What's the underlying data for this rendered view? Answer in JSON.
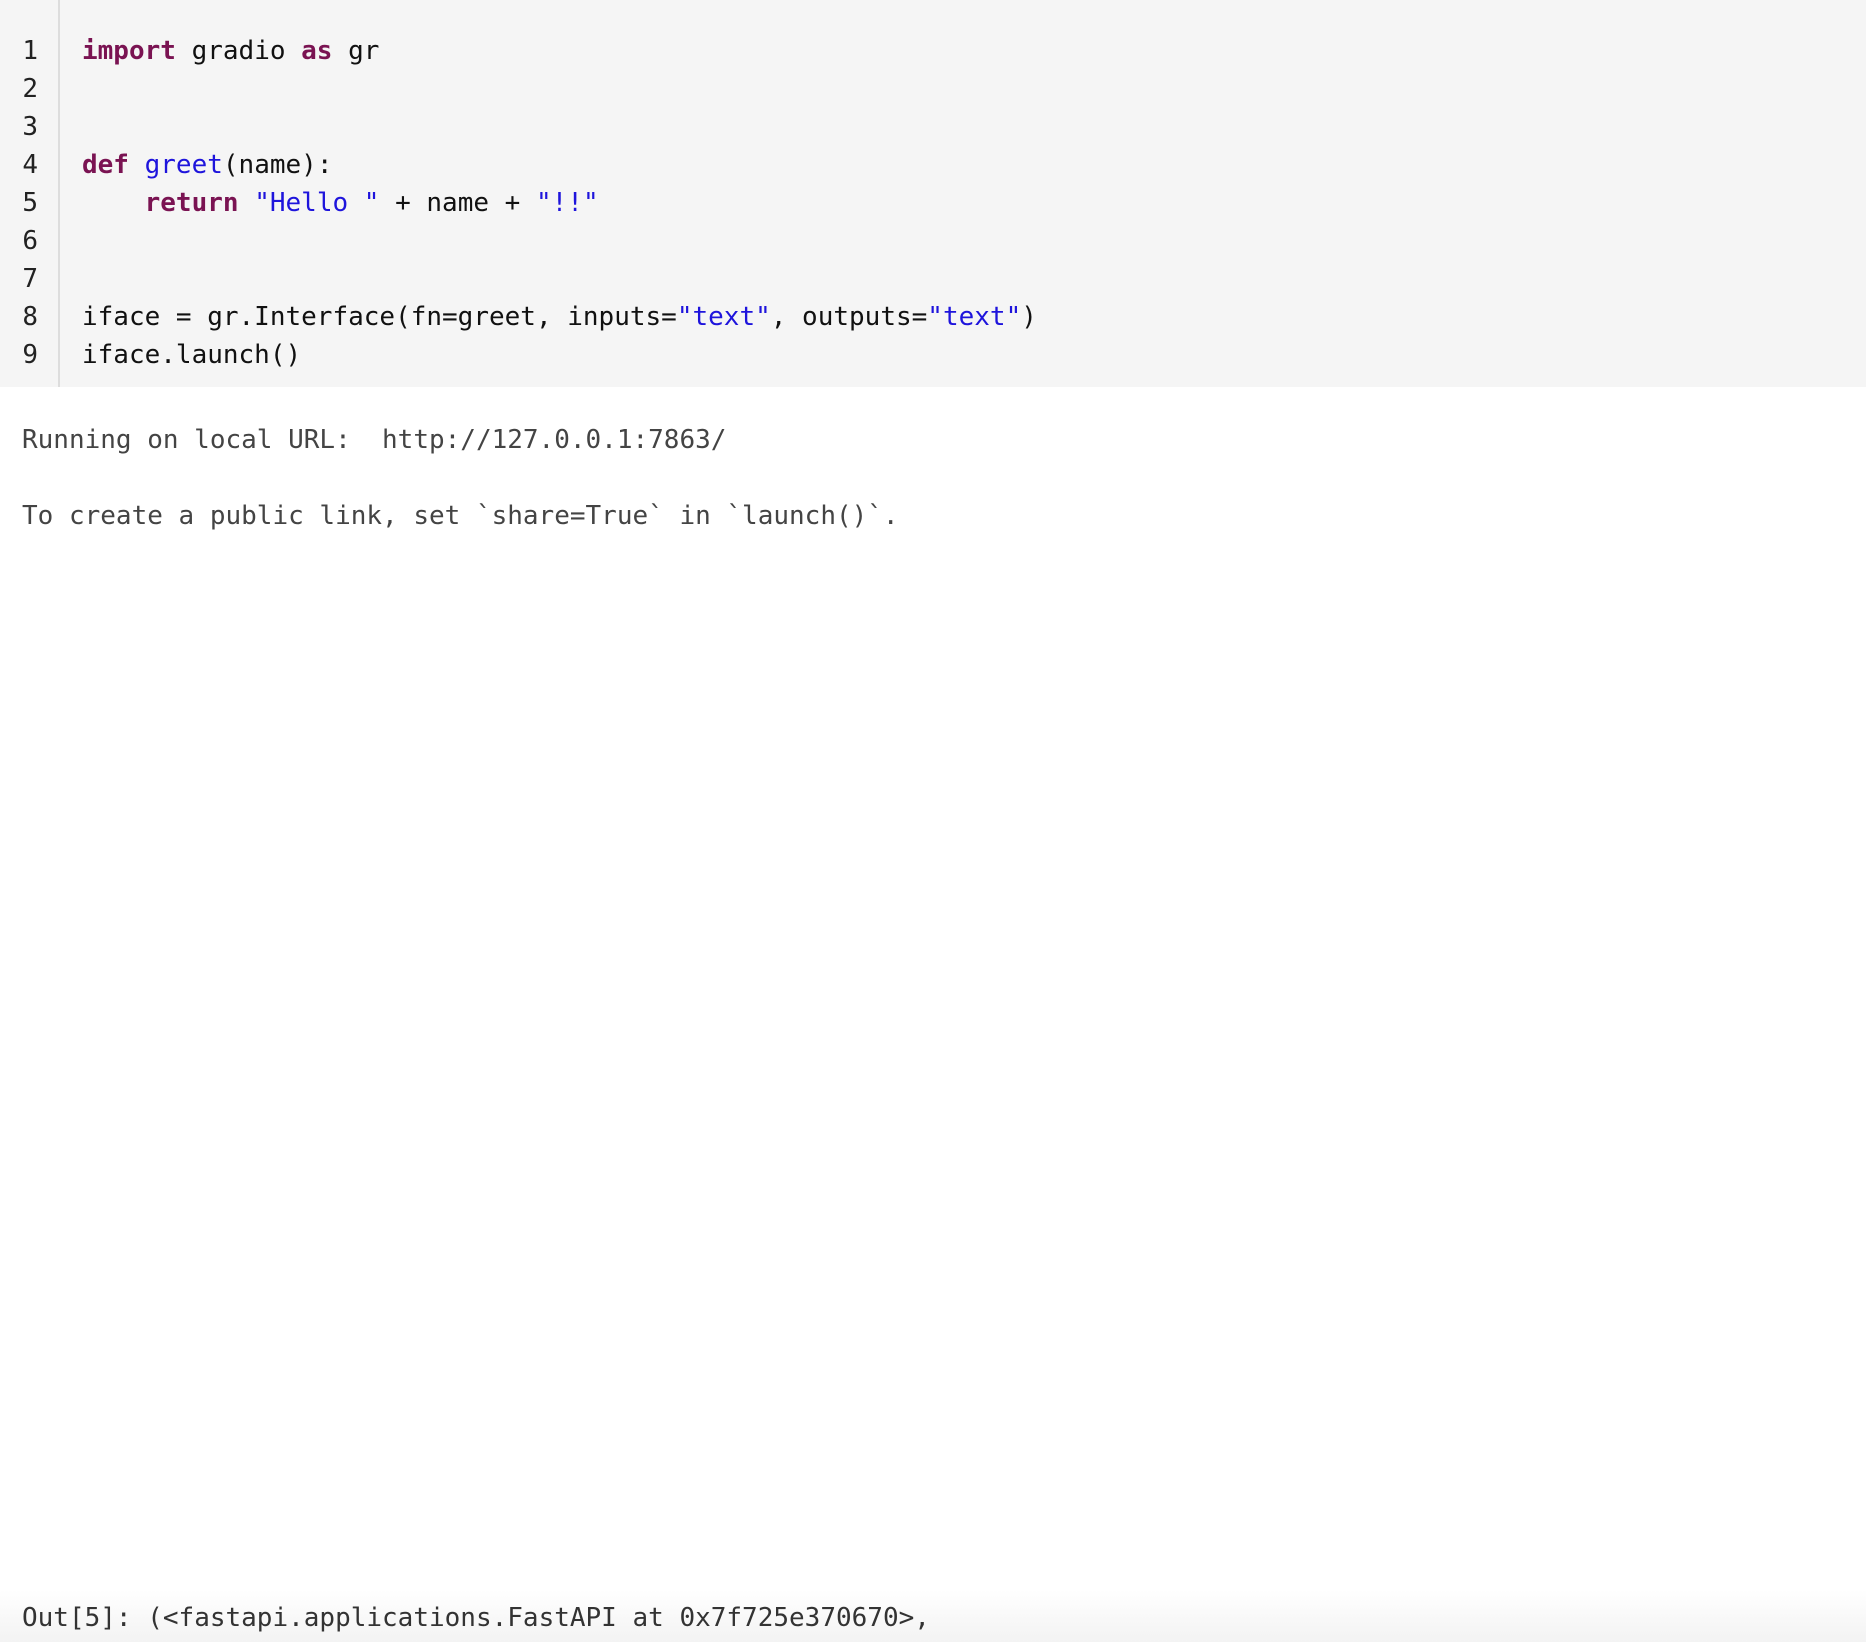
{
  "code_cell": {
    "line_numbers": [
      "1",
      "2",
      "3",
      "4",
      "5",
      "6",
      "7",
      "8",
      "9"
    ],
    "lines": {
      "l1": {
        "kw_import": "import",
        "t1": " gradio ",
        "kw_as": "as",
        "t2": " gr"
      },
      "l4": {
        "kw_def": "def",
        "t1": " ",
        "fn_name": "greet",
        "t2": "(name):"
      },
      "l5": {
        "indent": "    ",
        "kw_return": "return",
        "t1": " ",
        "s1": "\"Hello \"",
        "t2": " + name + ",
        "s2": "\"!!\""
      },
      "l8": {
        "t1": "iface = gr.Interface(fn=greet, inputs=",
        "s1": "\"text\"",
        "t2": ", outputs=",
        "s2": "\"text\"",
        "t3": ")"
      },
      "l9": {
        "t1": "iface.launch()"
      }
    }
  },
  "stdout": {
    "line1": "Running on local URL:  http://127.0.0.1:7863/",
    "line2": "To create a public link, set `share=True` in `launch()`."
  },
  "result": {
    "prompt": "Out[5]:",
    "value": " (<fastapi.applications.FastAPI at 0x7f725e370670>,"
  },
  "colors": {
    "keyword": "#7a1352",
    "string": "#1e14dc",
    "function": "#1e14dc",
    "code_background": "#f5f5f5",
    "output_text": "#444444"
  }
}
